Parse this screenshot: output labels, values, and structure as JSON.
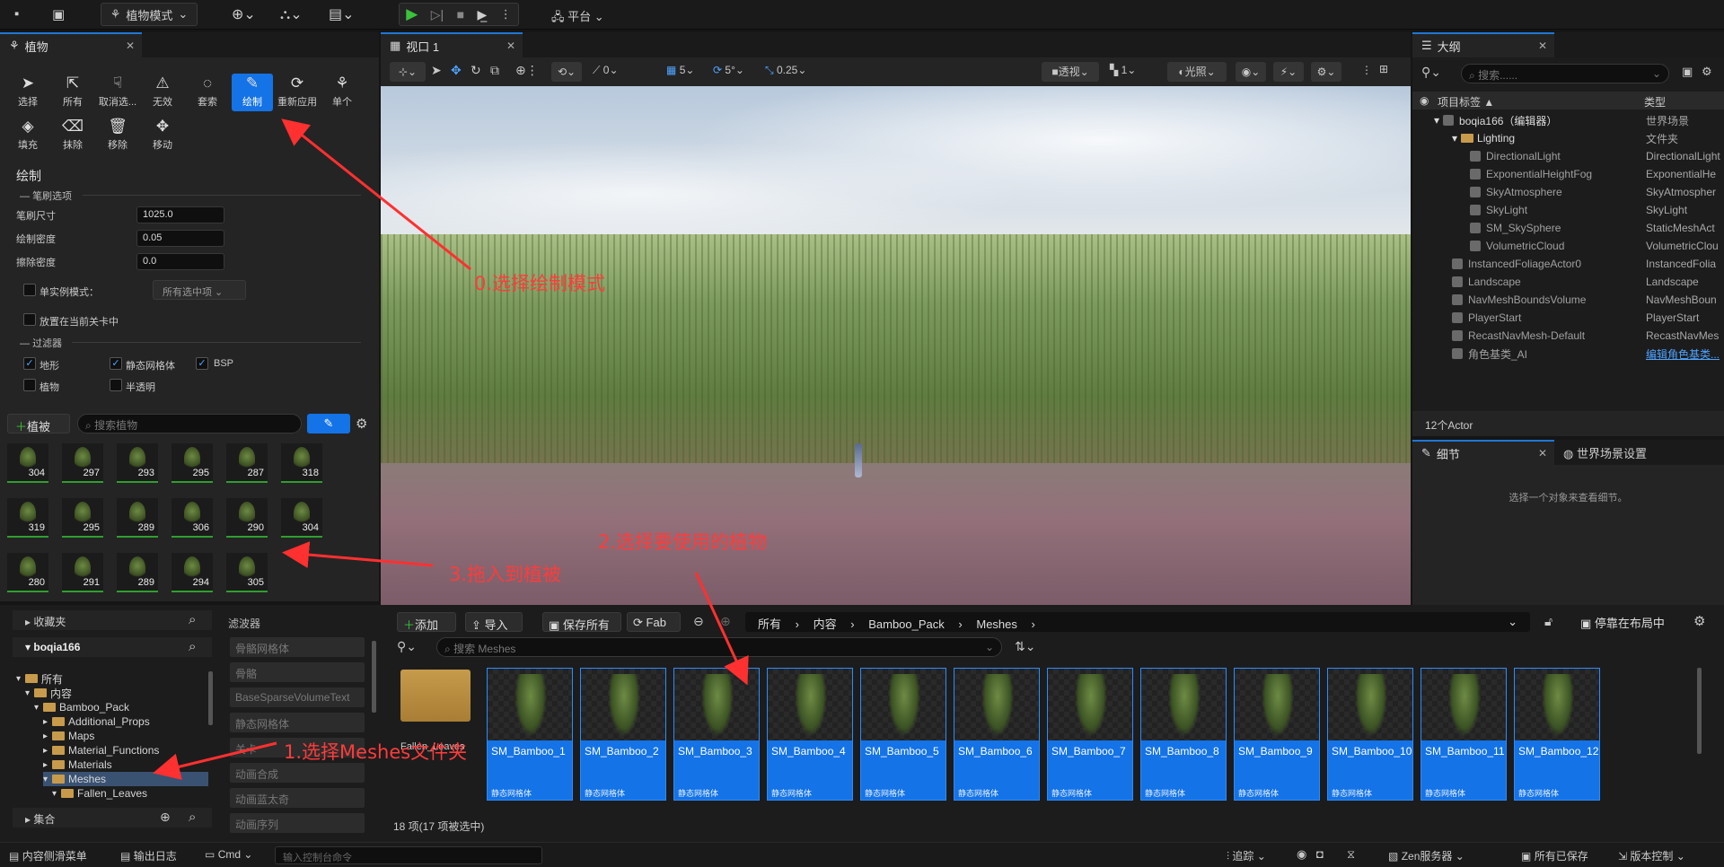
{
  "toolbar": {
    "mode": "植物模式",
    "platform": "平台"
  },
  "foliage": {
    "tab": "植物",
    "tools": [
      {
        "label": "选择",
        "icon": "cursor-icon"
      },
      {
        "label": "所有",
        "icon": "select-all-icon"
      },
      {
        "label": "取消选...",
        "icon": "deselect-icon"
      },
      {
        "label": "无效",
        "icon": "invalid-icon"
      },
      {
        "label": "套索",
        "icon": "lasso-icon"
      },
      {
        "label": "绘制",
        "icon": "paint-brush-icon",
        "selected": true
      },
      {
        "label": "重新应用",
        "icon": "reapply-icon"
      },
      {
        "label": "单个",
        "icon": "single-icon"
      },
      {
        "label": "填充",
        "icon": "fill-icon"
      },
      {
        "label": "抹除",
        "icon": "erase-icon"
      },
      {
        "label": "移除",
        "icon": "trash-icon"
      },
      {
        "label": "移动",
        "icon": "move-icon"
      }
    ],
    "section_title": "绘制",
    "brush_group": "笔刷选项",
    "brush_size_label": "笔刷尺寸",
    "brush_size": "1025.0",
    "paint_density_label": "绘制密度",
    "paint_density": "0.05",
    "erase_density_label": "擦除密度",
    "erase_density": "0.0",
    "single_instance_label": "单实例模式：",
    "single_instance_value": "所有选中项",
    "place_level_label": "放置在当前关卡中",
    "filter_group": "过滤器",
    "filters": [
      {
        "label": "地形",
        "checked": true
      },
      {
        "label": "静态网格体",
        "checked": true
      },
      {
        "label": "BSP",
        "checked": true
      },
      {
        "label": "植物",
        "checked": false
      },
      {
        "label": "半透明",
        "checked": false
      }
    ],
    "add_button": "植被",
    "search_placeholder": "搜索植物",
    "counts": [
      "304",
      "297",
      "293",
      "295",
      "287",
      "318",
      "319",
      "295",
      "289",
      "306",
      "290",
      "304",
      "280",
      "291",
      "289",
      "294",
      "305"
    ]
  },
  "viewport": {
    "tab": "视口 1",
    "items": {
      "snap_rot": "0",
      "grid": "5",
      "angle": "5°",
      "scale": "0.25",
      "perspective": "透视",
      "lighting": "光照",
      "cam": "1"
    }
  },
  "outliner": {
    "tab": "大纲",
    "search_placeholder": "搜索......",
    "col_label": "项目标签 ▲",
    "col_type": "类型",
    "rows": [
      {
        "name": "boqia166（编辑器）",
        "type": "世界场景"
      },
      {
        "name": "Lighting",
        "type": "文件夹"
      },
      {
        "name": "DirectionalLight",
        "type": "DirectionalLight"
      },
      {
        "name": "ExponentialHeightFog",
        "type": "ExponentialHe"
      },
      {
        "name": "SkyAtmosphere",
        "type": "SkyAtmospher"
      },
      {
        "name": "SkyLight",
        "type": "SkyLight"
      },
      {
        "name": "SM_SkySphere",
        "type": "StaticMeshAct"
      },
      {
        "name": "VolumetricCloud",
        "type": "VolumetricClou"
      },
      {
        "name": "InstancedFoliageActor0",
        "type": "InstancedFolia"
      },
      {
        "name": "Landscape",
        "type": "Landscape"
      },
      {
        "name": "NavMeshBoundsVolume",
        "type": "NavMeshBoun"
      },
      {
        "name": "PlayerStart",
        "type": "PlayerStart"
      },
      {
        "name": "RecastNavMesh-Default",
        "type": "RecastNavMes"
      },
      {
        "name": "角色基类_AI",
        "type": "编辑角色基类..."
      }
    ],
    "count": "12个Actor"
  },
  "details": {
    "tab": "细节",
    "world_tab": "世界场景设置",
    "hint": "选择一个对象来查看细节。"
  },
  "content": {
    "favorites": "收藏夹",
    "project": "boqia166",
    "collections": "集合",
    "tree": [
      {
        "name": "所有",
        "level": 0
      },
      {
        "name": "内容",
        "level": 1
      },
      {
        "name": "Bamboo_Pack",
        "level": 2
      },
      {
        "name": "Additional_Props",
        "level": 3
      },
      {
        "name": "Maps",
        "level": 3
      },
      {
        "name": "Material_Functions",
        "level": 3
      },
      {
        "name": "Materials",
        "level": 3
      },
      {
        "name": "Meshes",
        "level": 3,
        "selected": true
      },
      {
        "name": "Fallen_Leaves",
        "level": 4
      }
    ],
    "filters_title": "滤波器",
    "filters": [
      "骨骼网格体",
      "骨骼",
      "BaseSparseVolumeText",
      "静态网格体",
      "关卡",
      "动画合成",
      "动画蓝太奇",
      "动画序列"
    ],
    "add": "添加",
    "import": "导入",
    "save_all": "保存所有",
    "fab": "Fab",
    "path": [
      "所有",
      "内容",
      "Bamboo_Pack",
      "Meshes"
    ],
    "dock": "停靠在布局中",
    "search_placeholder": "搜索 Meshes",
    "folder_name": "Fallen_Leaves",
    "asset_type": "静态网格体",
    "assets": [
      "SM_Bamboo_1",
      "SM_Bamboo_2",
      "SM_Bamboo_3",
      "SM_Bamboo_4",
      "SM_Bamboo_5",
      "SM_Bamboo_6",
      "SM_Bamboo_7",
      "SM_Bamboo_8",
      "SM_Bamboo_9",
      "SM_Bamboo_10",
      "SM_Bamboo_11",
      "SM_Bamboo_12"
    ],
    "status": "18 项(17 项被选中)"
  },
  "statusbar": {
    "drawer": "内容侧滑菜单",
    "log": "输出日志",
    "cmd": "Cmd",
    "cmd_placeholder": "输入控制台命令",
    "trace": "追踪",
    "zen": "Zen服务器",
    "saved": "所有已保存",
    "vc": "版本控制"
  },
  "annotations": [
    "0.选择绘制模式",
    "1.选择Meshes文件夹",
    "2.选择要使用的植物",
    "3.拖入到植被"
  ]
}
